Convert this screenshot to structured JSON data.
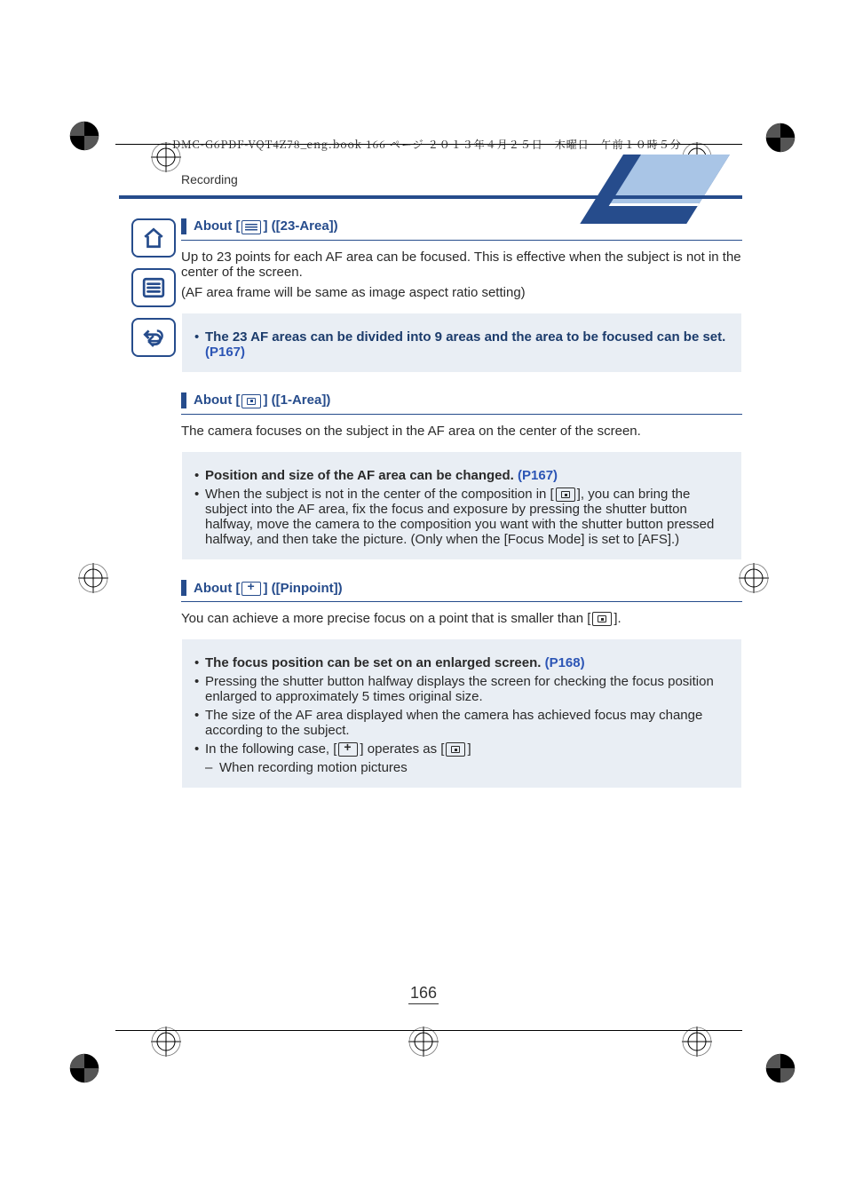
{
  "header_tag": "DMC-G6PDF-VQT4Z78_eng.book  166 ページ  ２０１３年４月２５日　木曜日　午前１０時５分",
  "section": "Recording",
  "page_number": "166",
  "sidebar": [
    {
      "name": "home-icon"
    },
    {
      "name": "menu-icon"
    },
    {
      "name": "back-icon"
    }
  ],
  "sec23": {
    "t_before": "About [",
    "t_after": "] ([23-Area])",
    "body1": "Up to 23 points for each AF area can be focused. This is effective when the subject is not in the center of the screen.",
    "body2": "(AF area frame will be same as image aspect ratio setting)",
    "note_bold": "The 23 AF areas can be divided into 9 areas and the area to be focused can be set.",
    "note_link": "(P167)"
  },
  "sec1": {
    "t_before": "About [",
    "t_after": "] ([1-Area])",
    "body": "The camera focuses on the subject in the AF area on the center of the screen.",
    "note_b1": "Position and size of the AF area can be changed. ",
    "note_link1": "(P167)",
    "note_li2a": "When the subject is not in the center of the composition in [",
    "note_li2b": "], you can bring the subject into the AF area, fix the focus and exposure by pressing the shutter button halfway, move the camera to the composition you want with the shutter button pressed halfway, and then take the picture. (Only when the [Focus Mode] is set to [AFS].)"
  },
  "secpin": {
    "t_before": "About [",
    "t_after": "] ([Pinpoint])",
    "body_a": "You can achieve a more precise focus on a point that is smaller than [",
    "body_b": "].",
    "note_b1": "The focus position can be set on an enlarged screen. ",
    "note_link1": "(P168)",
    "note_li2": "Pressing the shutter button halfway displays the screen for checking the focus position enlarged to approximately 5 times original size.",
    "note_li3": "The size of the AF area displayed when the camera has achieved focus may change according to the subject.",
    "note_li4a": "In the following case, [",
    "note_li4b": "] operates as [",
    "note_li4c": "]",
    "note_li4_sub": "When recording motion pictures"
  }
}
